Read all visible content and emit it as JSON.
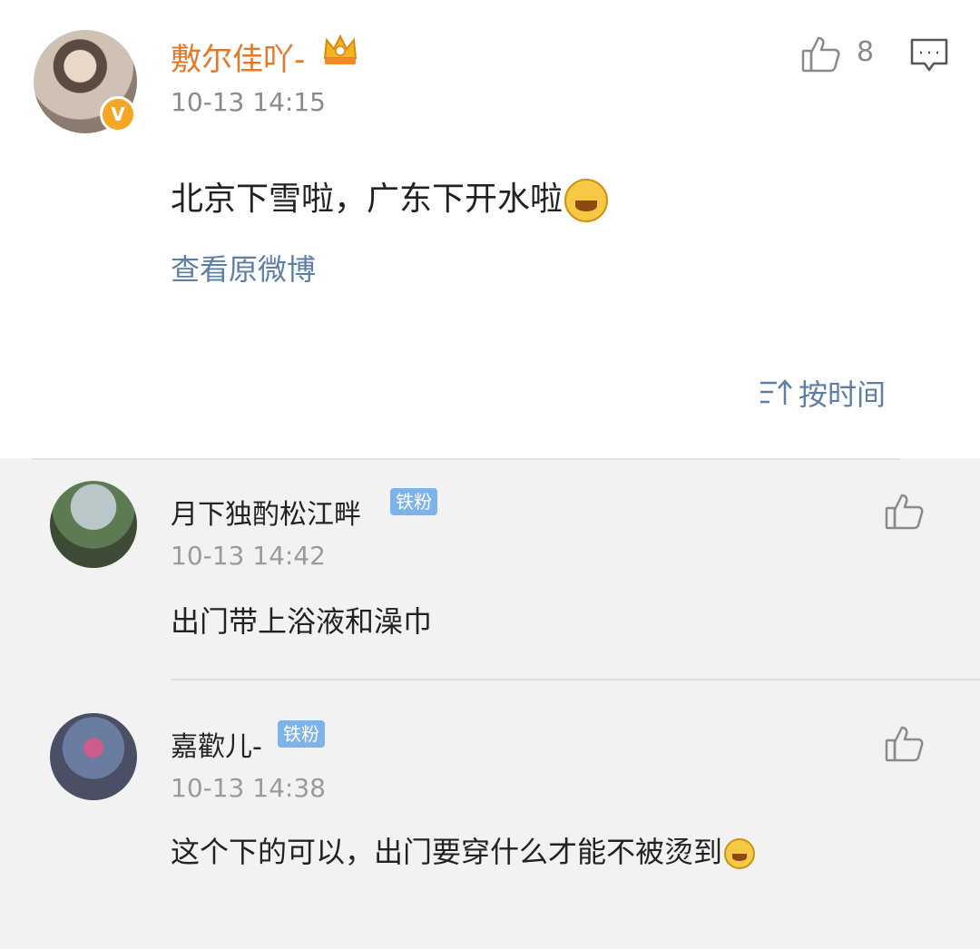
{
  "post": {
    "author": "敷尔佳吖-",
    "verified_mark": "V",
    "time": "10-13 14:15",
    "like_count": "8",
    "text": "北京下雪啦，广东下开水啦",
    "view_original": "查看原微博"
  },
  "sort": {
    "label": "按时间"
  },
  "comments": [
    {
      "author": "月下独酌松江畔",
      "badge": "铁粉",
      "time": "10-13 14:42",
      "text": "出门带上浴液和澡巾"
    },
    {
      "author": "嘉歡儿-",
      "badge": "铁粉",
      "time": "10-13 14:38",
      "text": "这个下的可以，出门要穿什么才能不被烫到"
    }
  ],
  "icons": {
    "like": "thumbs-up-icon",
    "comment": "comment-icon",
    "sort": "sort-icon",
    "crown": "crown-icon",
    "emoji_top": "laugh-cry-emoji",
    "emoji_bottom": "laugh-emoji"
  },
  "colors": {
    "author_name": "#e07a2a",
    "link": "#5d7fa6",
    "badge": "#7db3e8",
    "verified": "#f5a623"
  }
}
